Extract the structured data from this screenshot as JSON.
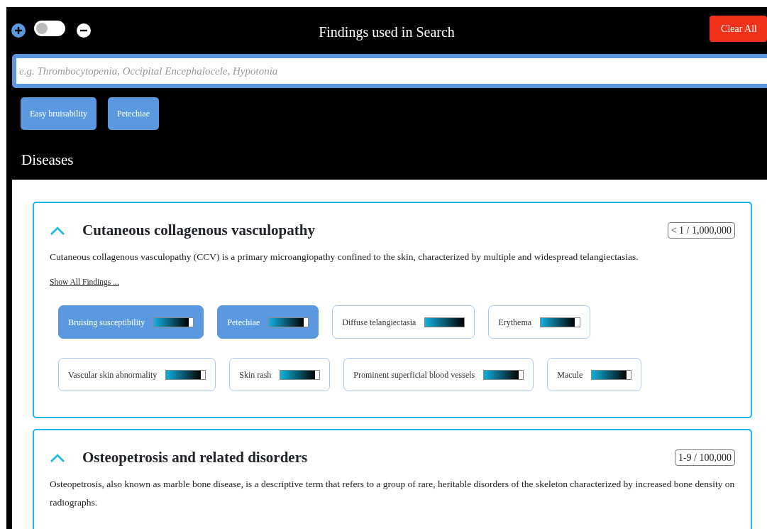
{
  "header": {
    "title": "Findings used in Search",
    "toggle": {
      "on": false
    },
    "clear_button": "Clear All"
  },
  "search": {
    "placeholder": "e.g. Thrombocytopenia, Occipital Encephalocele, Hypotonia"
  },
  "selected_findings": [
    "Easy bruisability",
    "Petechiae"
  ],
  "section_title": "Diseases",
  "diseases": [
    {
      "name": "Cutaneous collagenous vasculopathy",
      "expanded": true,
      "prevalence": "< 1 / 1,000,000",
      "description": "Cutaneous collagenous vasculopathy (CCV) is a primary microangiopathy confined to the skin, characterized by multiple and widespread telangiectasias.",
      "show_all": "Show All Findings ...",
      "findings": [
        {
          "label": "Bruising susceptibility",
          "selected": true,
          "level": 0.88
        },
        {
          "label": "Petechiae",
          "selected": true,
          "level": 0.88
        },
        {
          "label": "Diffuse telangiectasia",
          "selected": false,
          "level": 1
        },
        {
          "label": "Erythema",
          "selected": false,
          "level": 0.88
        },
        {
          "label": "Vascular skin abnormality",
          "selected": false,
          "level": 0.88
        },
        {
          "label": "Skin rash",
          "selected": false,
          "level": 0.88
        },
        {
          "label": "Prominent superficial blood vessels",
          "selected": false,
          "level": 0.88
        },
        {
          "label": "Macule",
          "selected": false,
          "level": 0.88
        }
      ]
    },
    {
      "name": "Osteopetrosis and related disorders",
      "expanded": true,
      "prevalence": "1-9 / 100,000",
      "description": "Osteopetrosis, also known as marble bone disease, is a descriptive term that refers to a group of rare, heritable disorders of the skeleton characterized by increased bone density on radiographs."
    }
  ]
}
